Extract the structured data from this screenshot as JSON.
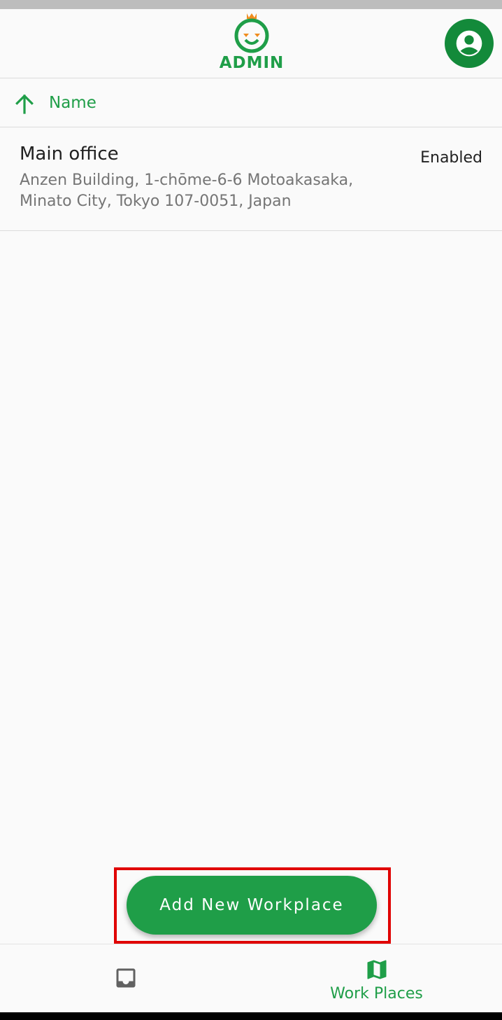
{
  "header": {
    "logo_text": "ADMIN",
    "account_icon": "account-circle-icon"
  },
  "sort": {
    "direction_icon": "arrow-up-icon",
    "label": "Name"
  },
  "workplaces": [
    {
      "name": "Main office",
      "address": "Anzen Building, 1-chōme-6-6 Motoakasaka, Minato City, Tokyo 107-0051, Japan",
      "status": "Enabled"
    }
  ],
  "fab": {
    "label": "Add New Workplace"
  },
  "bottom_nav": {
    "items": [
      {
        "icon": "inbox-icon",
        "label": "",
        "active": false
      },
      {
        "icon": "map-icon",
        "label": "Work Places",
        "active": true
      }
    ]
  },
  "colors": {
    "brand_green": "#1f9e48",
    "account_green": "#138a3a",
    "logo_orange": "#f08c1e",
    "highlight_red": "#e00000"
  }
}
